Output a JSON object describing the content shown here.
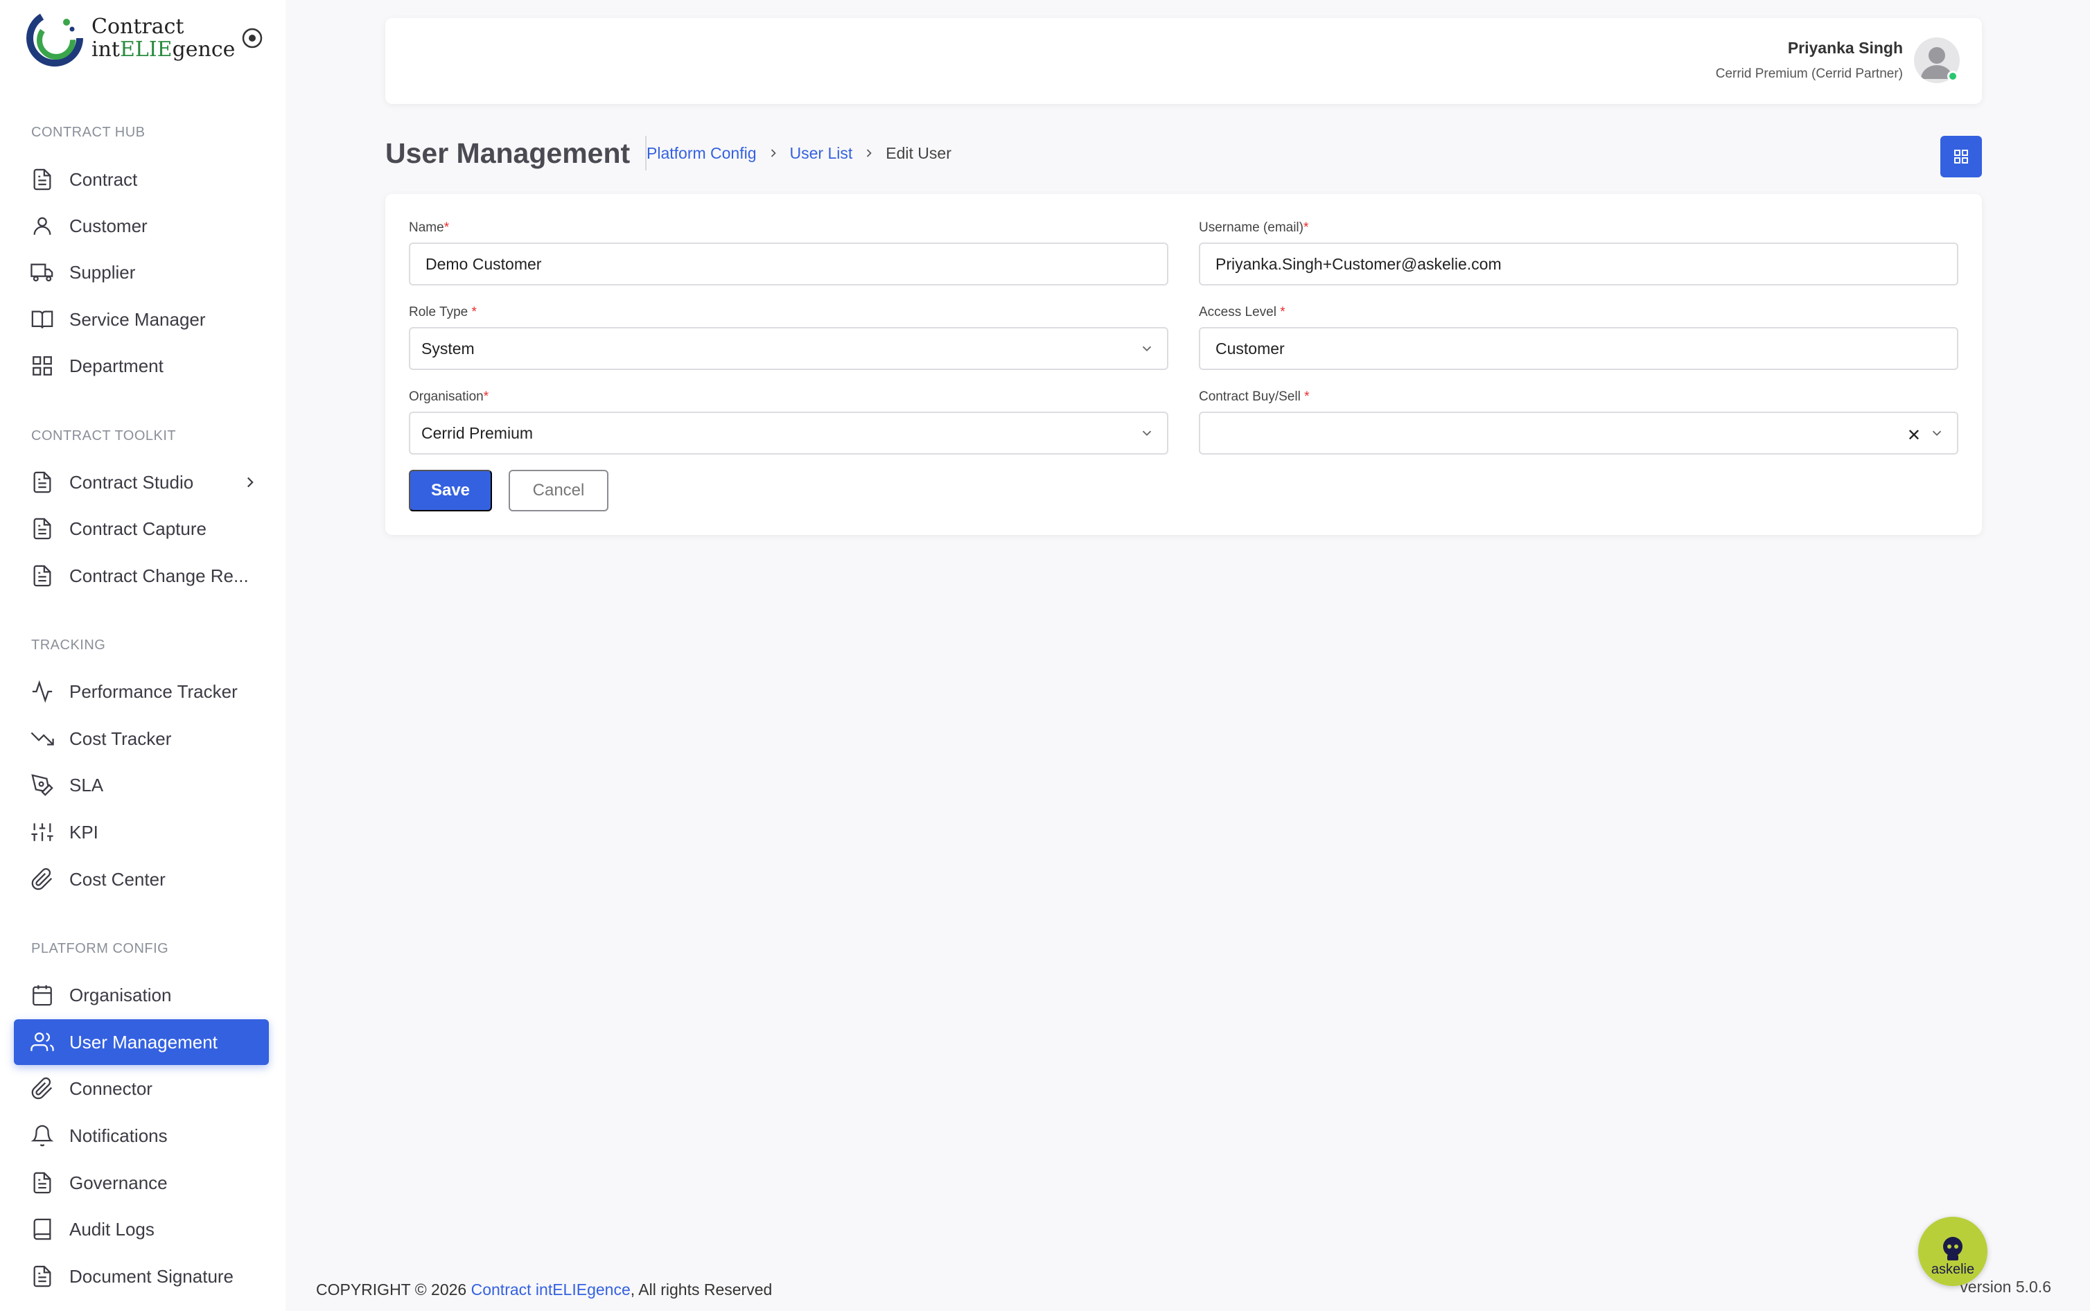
{
  "brand": {
    "logo_line1": "Contract",
    "logo_line2_a": "int",
    "logo_line2_b": "ELIE",
    "logo_line2_c": "gence"
  },
  "sidebar": {
    "sections": [
      {
        "title": "CONTRACT HUB"
      },
      {
        "title": "CONTRACT TOOLKIT"
      },
      {
        "title": "TRACKING"
      },
      {
        "title": "PLATFORM CONFIG"
      }
    ],
    "items": [
      {
        "label": "Contract",
        "icon": "document-icon"
      },
      {
        "label": "Customer",
        "icon": "user-icon"
      },
      {
        "label": "Supplier",
        "icon": "truck-icon"
      },
      {
        "label": "Service Manager",
        "icon": "book-open-icon"
      },
      {
        "label": "Department",
        "icon": "grid-icon"
      },
      {
        "label": "Contract Studio",
        "icon": "document-icon"
      },
      {
        "label": "Contract Capture",
        "icon": "document-icon"
      },
      {
        "label": "Contract Change Re...",
        "icon": "document-icon"
      },
      {
        "label": "Performance Tracker",
        "icon": "activity-icon"
      },
      {
        "label": "Cost Tracker",
        "icon": "trending-down-icon"
      },
      {
        "label": "SLA",
        "icon": "pen-tool-icon"
      },
      {
        "label": "KPI",
        "icon": "sliders-icon"
      },
      {
        "label": "Cost Center",
        "icon": "paperclip-icon"
      },
      {
        "label": "Organisation",
        "icon": "calendar-icon"
      },
      {
        "label": "User Management",
        "icon": "users-icon"
      },
      {
        "label": "Connector",
        "icon": "paperclip-icon"
      },
      {
        "label": "Notifications",
        "icon": "bell-icon"
      },
      {
        "label": "Governance",
        "icon": "document-icon"
      },
      {
        "label": "Audit Logs",
        "icon": "book-icon"
      },
      {
        "label": "Document Signature",
        "icon": "document-icon"
      }
    ]
  },
  "header": {
    "user_name": "Priyanka Singh",
    "user_org": "Cerrid Premium (Cerrid Partner)"
  },
  "page": {
    "title": "User Management",
    "breadcrumb": [
      "Platform Config",
      "User List",
      "Edit User"
    ]
  },
  "form": {
    "name_label": "Name",
    "name_value": "Demo Customer",
    "username_label": "Username (email)",
    "username_value": "Priyanka.Singh+Customer@askelie.com",
    "role_label": "Role Type ",
    "role_value": "System",
    "access_label": "Access Level ",
    "access_value": "Customer",
    "org_label": "Organisation",
    "org_value": "Cerrid Premium",
    "buysell_label": "Contract Buy/Sell ",
    "buysell_value": "",
    "required_mark": "*",
    "save_label": "Save",
    "cancel_label": "Cancel"
  },
  "footer": {
    "copyright": "COPYRIGHT © 2026 ",
    "brand": "Contract intELIEgence",
    "rights": ", All rights Reserved",
    "version": "version 5.0.6"
  },
  "assistant": {
    "label": "askelie"
  },
  "colors": {
    "accent": "#3461e0",
    "required": "#ea2a2a",
    "online": "#28c76f",
    "assistant_bg": "#b9cf3a"
  }
}
